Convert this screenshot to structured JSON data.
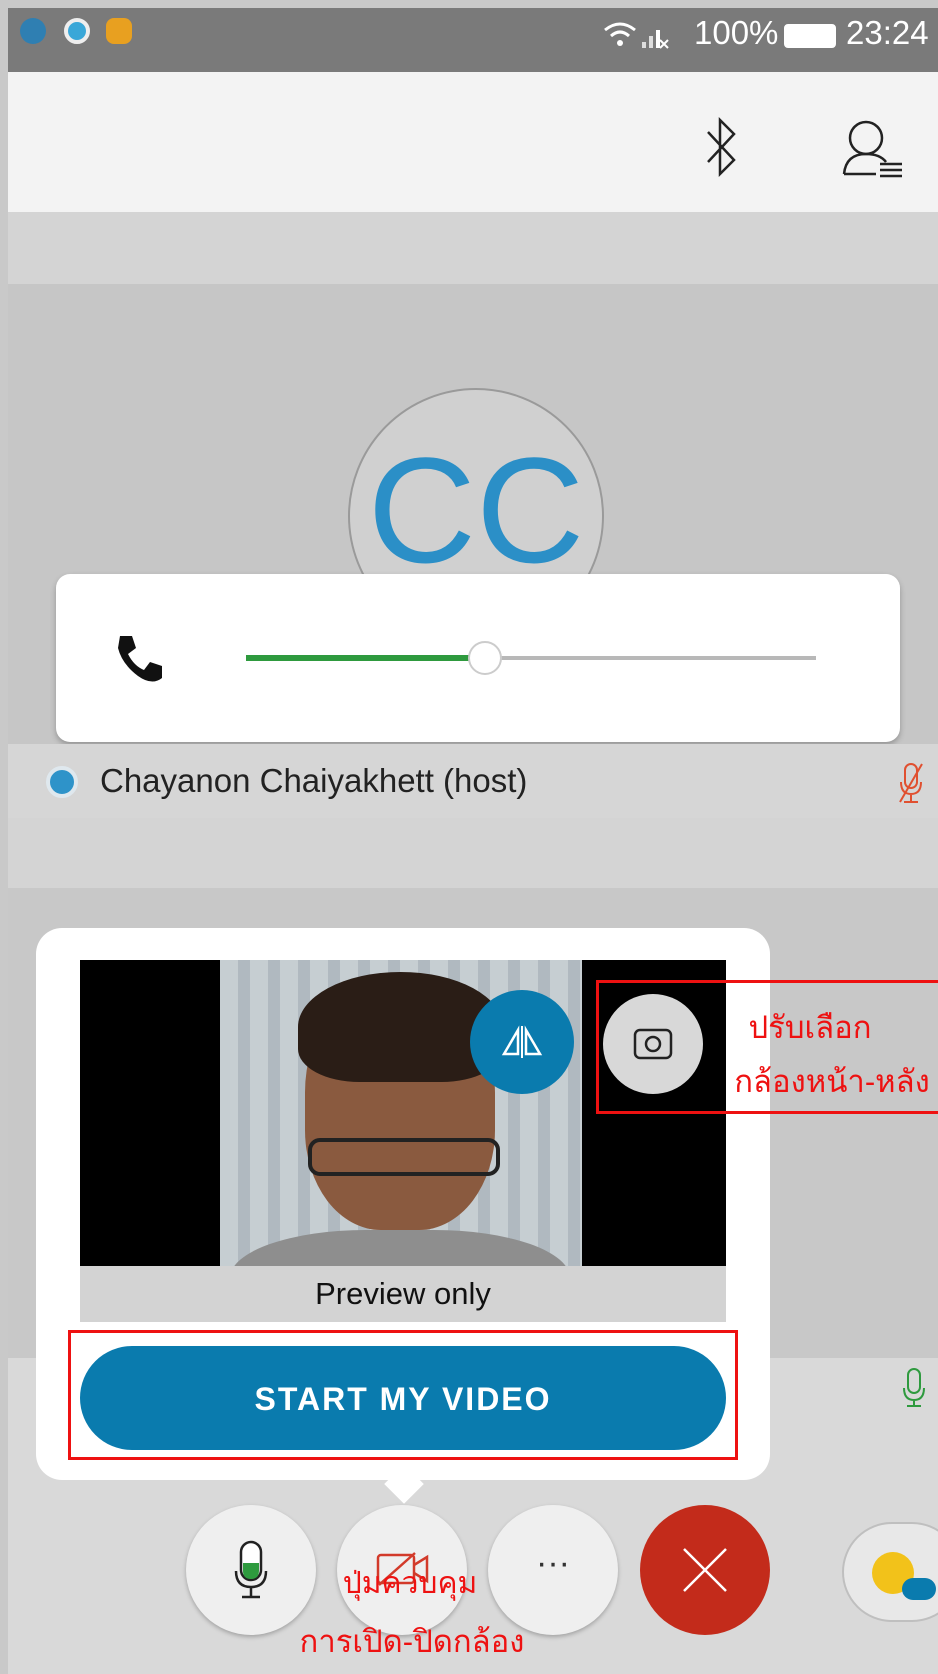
{
  "status_bar": {
    "battery": "100%",
    "time": "23:24"
  },
  "participant": {
    "initials": "CC",
    "name": "Chayanon Chaiyakhett (host)"
  },
  "volume": {
    "level": 0.42
  },
  "video_preview": {
    "preview_label": "Preview only",
    "start_button": "START MY VIDEO"
  },
  "annotations": {
    "camera_switch_line1": "ปรับเลือก",
    "camera_switch_line2": "กล้องหน้า-หลัง",
    "camera_toggle_line1": "ปุ่มควบคุม",
    "camera_toggle_line2": "การเปิด-ปิดกล้อง"
  },
  "controls": {
    "more_label": "···"
  },
  "colors": {
    "accent": "#0a7bae",
    "end_call": "#c32b1b",
    "annotation": "#e11111",
    "slider_active": "#2e9a3e"
  }
}
